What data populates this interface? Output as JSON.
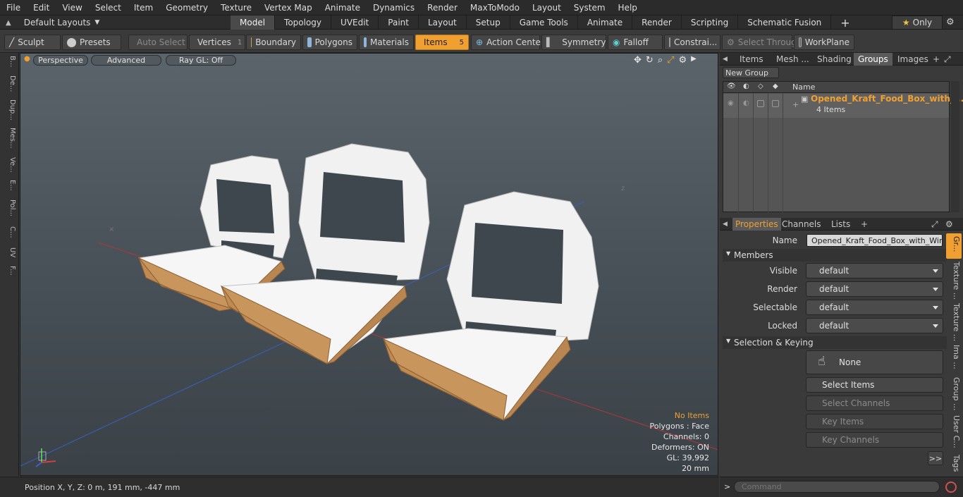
{
  "menubar": [
    "File",
    "Edit",
    "View",
    "Select",
    "Item",
    "Geometry",
    "Texture",
    "Vertex Map",
    "Animate",
    "Dynamics",
    "Render",
    "MaxToModo",
    "Layout",
    "System",
    "Help"
  ],
  "layouts": {
    "label": "Default Layouts"
  },
  "tabs": [
    "Model",
    "Topology",
    "UVEdit",
    "Paint",
    "Layout",
    "Setup",
    "Game Tools",
    "Animate",
    "Render",
    "Scripting",
    "Schematic Fusion"
  ],
  "only_label": "Only",
  "toolbar": {
    "sculpt": "Sculpt",
    "presets": "Presets",
    "auto_select": "Auto Select",
    "vertices": "Vertices",
    "vertices_count": "1",
    "boundary": "Boundary",
    "polygons": "Polygons",
    "materials": "Materials",
    "items": "Items",
    "items_count": "5",
    "action_center": "Action Center",
    "symmetry": "Symmetry",
    "falloff": "Falloff",
    "constraints": "Constrai...",
    "select_through": "Select Through",
    "workplane": "WorkPlane"
  },
  "left_tabs": [
    "B...",
    "De...",
    "Dup...",
    "Mes...",
    "Ve...",
    "E...",
    "Pol...",
    "C...",
    "UV",
    "F..."
  ],
  "viewport": {
    "perspective": "Perspective",
    "advanced": "Advanced",
    "raygl": "Ray GL: Off",
    "hud": {
      "no_items": "No Items",
      "polygons": "Polygons : Face",
      "channels": "Channels: 0",
      "deformers": "Deformers: ON",
      "gl": "GL: 39,992",
      "scale": "20 mm"
    }
  },
  "status": {
    "position": "Position X, Y, Z:   0 m, 191 mm, -447 mm"
  },
  "right_top": {
    "tabs": [
      "Items",
      "Mesh ...",
      "Shading",
      "Groups",
      "Images"
    ],
    "new_group": "New Group",
    "col_name": "Name",
    "group_name": "Opened_Kraft_Food_Box_with_ ...",
    "group_count": "4 Items"
  },
  "properties": {
    "tabs": [
      "Properties",
      "Channels",
      "Lists"
    ],
    "name_label": "Name",
    "name_value": "Opened_Kraft_Food_Box_with_Windo",
    "members": "Members",
    "visible_label": "Visible",
    "visible": "default",
    "render_label": "Render",
    "render": "default",
    "selectable_label": "Selectable",
    "selectable": "default",
    "locked_label": "Locked",
    "locked": "default",
    "sel_keying": "Selection & Keying",
    "none": "None",
    "select_items": "Select Items",
    "select_channels": "Select Channels",
    "key_items": "Key Items",
    "key_channels": "Key Channels",
    "more": ">>"
  },
  "right_vtabs": [
    "Gr...",
    "Texture ...",
    "Texture ...",
    "Ima ...",
    "Group ...",
    "User C...",
    "Tags"
  ],
  "command_placeholder": "Command",
  "colors": {
    "accent": "#f0a030",
    "kraft": "#c8955c"
  }
}
